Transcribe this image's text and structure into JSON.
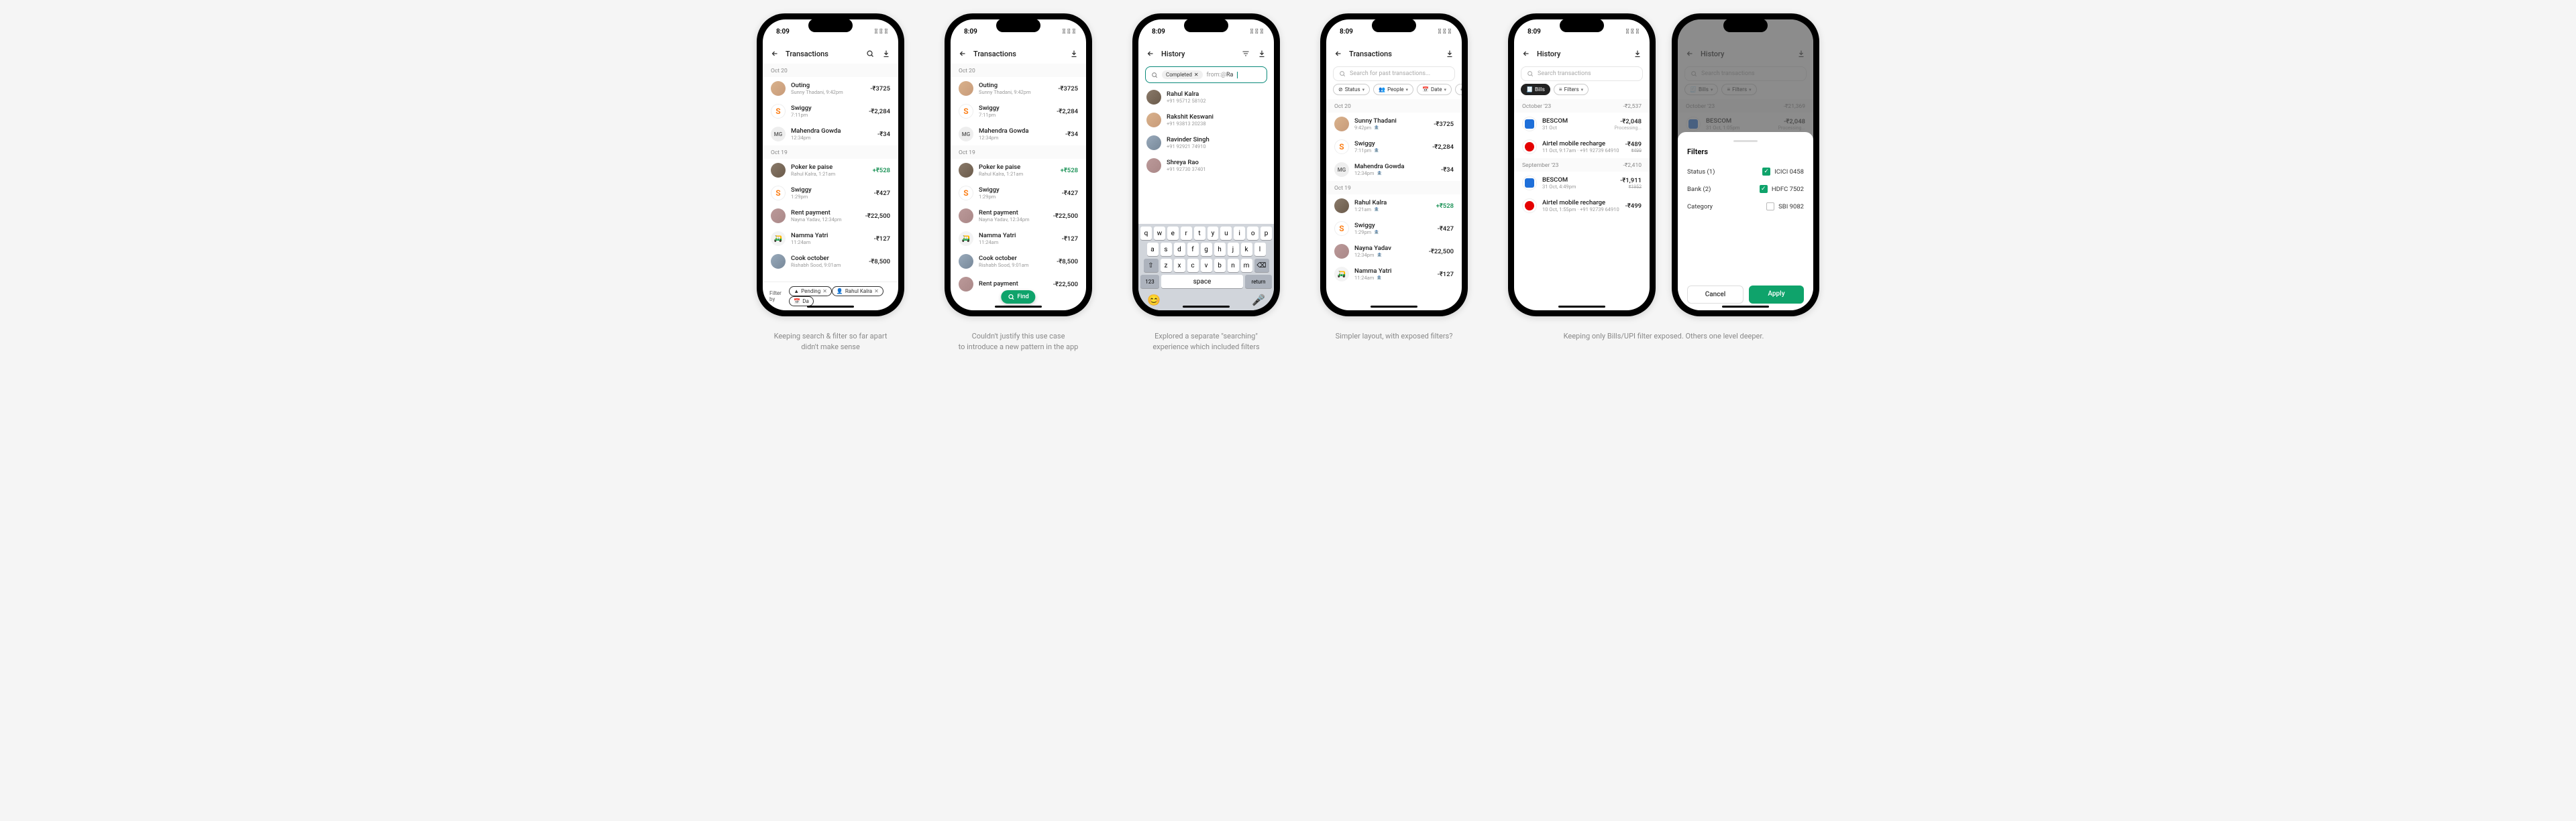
{
  "status": {
    "time": "8:09"
  },
  "screens": {
    "s1": {
      "title": "Transactions",
      "groups": [
        {
          "date": "Oct 20",
          "rows": [
            {
              "title": "Outing",
              "sub": "Sunny Thadani, 9:42pm",
              "amt": "-₹3725",
              "av": "person"
            },
            {
              "title": "Swiggy",
              "sub": "7:11pm",
              "amt": "-₹2,284",
              "av": "swiggy"
            },
            {
              "title": "Mahendra Gowda",
              "sub": "12:34pm",
              "amt": "-₹34",
              "av": "grey",
              "initials": "MG"
            }
          ]
        },
        {
          "date": "Oct 19",
          "rows": [
            {
              "title": "Poker ke paise",
              "sub": "Rahul Kalra, 1:21am",
              "amt": "+₹528",
              "pos": true,
              "av": "person2"
            },
            {
              "title": "Swiggy",
              "sub": "1:29pm",
              "amt": "-₹427",
              "av": "swiggy"
            },
            {
              "title": "Rent payment",
              "sub": "Nayna Yadav, 12:34pm",
              "amt": "-₹22,500",
              "av": "person3"
            },
            {
              "title": "Namma Yatri",
              "sub": "11:24am",
              "amt": "-₹127",
              "av": "auto",
              "initials": "🛺"
            },
            {
              "title": "Cook october",
              "sub": "Rishabh Sood, 9:01am",
              "amt": "-₹8,500",
              "av": "person4"
            }
          ]
        }
      ],
      "filterbar": {
        "label": "Filter by",
        "chips": [
          {
            "label": "Pending",
            "icon": "▲"
          },
          {
            "label": "Rahul Kalra",
            "icon": "👤"
          },
          {
            "label": "Da",
            "icon": "📅",
            "cut": true
          }
        ]
      }
    },
    "s2": {
      "title": "Transactions",
      "fab": "Find",
      "extra_row": {
        "title": "Rent payment",
        "amt": "-₹22,500"
      }
    },
    "s3": {
      "title": "History",
      "search": {
        "chip": "Completed",
        "typed": "from:@Ra"
      },
      "suggestions": [
        {
          "name": "Rahul Kalra",
          "sub": "+91 95712 58102",
          "av": "person2"
        },
        {
          "name": "Rakshit Keswani",
          "sub": "+91 93813 20238",
          "av": "person"
        },
        {
          "name": "Ravinder Singh",
          "sub": "+91 92921 74910",
          "av": "person4"
        },
        {
          "name": "Shreya Rao",
          "sub": "+91 92730 37401",
          "av": "person3"
        }
      ],
      "kbd": {
        "r1": [
          "q",
          "w",
          "e",
          "r",
          "t",
          "y",
          "u",
          "i",
          "o",
          "p"
        ],
        "r2": [
          "a",
          "s",
          "d",
          "f",
          "g",
          "h",
          "j",
          "k",
          "l"
        ],
        "r3": [
          "z",
          "x",
          "c",
          "v",
          "b",
          "n",
          "m"
        ],
        "num": "123",
        "space": "space",
        "ret": "return"
      }
    },
    "s4": {
      "title": "Transactions",
      "search_ph": "Search for past transactions...",
      "chips": [
        {
          "label": "Status",
          "icon": "⊘"
        },
        {
          "label": "People",
          "icon": "👥"
        },
        {
          "label": "Date",
          "icon": "📅"
        },
        {
          "label": "Typ",
          "icon": "≡",
          "cut": true
        }
      ],
      "groups": [
        {
          "date": "Oct 20",
          "rows": [
            {
              "title": "Sunny Thadani",
              "sub": "9:42pm",
              "amt": "-₹3725",
              "av": "person",
              "bank": true
            },
            {
              "title": "Swiggy",
              "sub": "7:11pm",
              "amt": "-₹2,284",
              "av": "swiggy",
              "bank": true
            },
            {
              "title": "Mahendra Gowda",
              "sub": "12:34pm",
              "amt": "-₹34",
              "av": "grey",
              "initials": "MG",
              "bank": true
            }
          ]
        },
        {
          "date": "Oct 19",
          "rows": [
            {
              "title": "Rahul Kalra",
              "sub": "1:21am",
              "amt": "+₹528",
              "pos": true,
              "av": "person2",
              "bank": true
            },
            {
              "title": "Swiggy",
              "sub": "1:29pm",
              "amt": "-₹427",
              "av": "swiggy",
              "bank": true
            },
            {
              "title": "Nayna Yadav",
              "sub": "12:34pm",
              "amt": "-₹22,500",
              "av": "person3",
              "bank": true
            },
            {
              "title": "Namma Yatri",
              "sub": "11:24am",
              "amt": "-₹127",
              "av": "auto",
              "initials": "🛺",
              "bank": true
            }
          ]
        }
      ]
    },
    "s5": {
      "title": "History",
      "search_ph": "Search transactions",
      "chips": [
        {
          "label": "Bills",
          "filled": true,
          "icon": "🧾"
        },
        {
          "label": "Filters",
          "icon": "≡"
        }
      ],
      "months": [
        {
          "label": "October '23",
          "total": "-₹2,537",
          "rows": [
            {
              "title": "BESCOM",
              "sub": "31 Oct",
              "amt": "-₹2,048",
              "amt_sub": "Processing...",
              "av": "bescom"
            },
            {
              "title": "Airtel mobile recharge",
              "sub": "11 Oct, 9:17am  ·  +91 92739 64910",
              "amt": "-₹489",
              "amt_sub": "₹499",
              "strike": true,
              "av": "airtel"
            }
          ]
        },
        {
          "label": "September '23",
          "total": "-₹2,410",
          "rows": [
            {
              "title": "BESCOM",
              "sub": "31 Oct, 4:49pm",
              "amt": "-₹1,911",
              "amt_sub": "₹1952",
              "strike": true,
              "av": "bescom"
            },
            {
              "title": "Airtel mobile recharge",
              "sub": "10 Oct, 1:55pm  ·  +91 92739 64910",
              "amt": "-₹499",
              "av": "airtel"
            }
          ]
        }
      ]
    },
    "s6": {
      "title": "History",
      "search_ph": "Search transactions",
      "chips_bg": [
        {
          "label": "Bills",
          "icon": "🧾"
        },
        {
          "label": "Filters",
          "icon": "≡"
        }
      ],
      "bg_month": {
        "label": "October '23",
        "total": "-₹21,369"
      },
      "bg_row": {
        "title": "BESCOM",
        "sub": "31 Oct, 1:05pm",
        "amt": "-₹2,048",
        "amt_sub": "Processing..."
      },
      "sheet": {
        "title": "Filters",
        "rows": [
          {
            "lab": "Status (1)",
            "val": "ICICI 0458",
            "on": true
          },
          {
            "lab": "Bank (2)",
            "val": "HDFC 7502",
            "on": true
          },
          {
            "lab": "Category",
            "val": "SBI 9082",
            "on": false
          }
        ],
        "cancel": "Cancel",
        "apply": "Apply"
      }
    }
  },
  "captions": {
    "c1": "Keeping search & filter so far apart\ndidn't make sense",
    "c2": "Couldn't justify this use case\nto introduce a new pattern in the app",
    "c3": "Explored a separate \"searching\"\nexperience which included filters",
    "c4": "Simpler layout, with exposed filters?",
    "c56": "Keeping only Bills/UPI filter exposed. Others one level deeper."
  }
}
